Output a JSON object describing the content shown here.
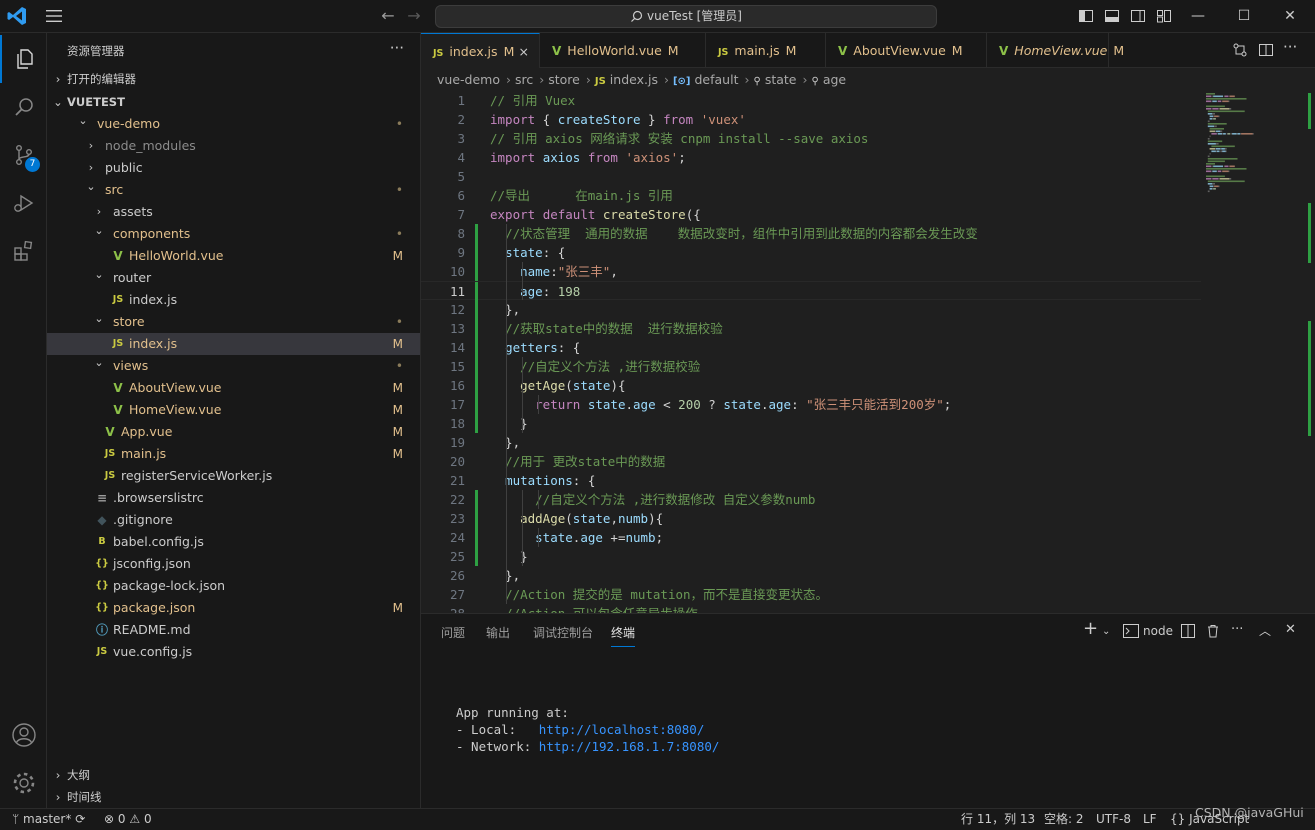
{
  "window": {
    "title": "vueTest [管理员]"
  },
  "explorer": {
    "title": "资源管理器",
    "sections": {
      "open_editors": "打开的编辑器",
      "workspace": "VUETEST",
      "outline": "大纲",
      "timeline": "时间线"
    },
    "tree": [
      {
        "label": "vue-demo",
        "depth": 1,
        "kind": "folder",
        "open": true,
        "deco": "•"
      },
      {
        "label": "node_modules",
        "depth": 2,
        "kind": "folder",
        "open": false,
        "deco": ""
      },
      {
        "label": "public",
        "depth": 2,
        "kind": "folder",
        "open": false,
        "deco": ""
      },
      {
        "label": "src",
        "depth": 2,
        "kind": "folder",
        "open": true,
        "deco": "•"
      },
      {
        "label": "assets",
        "depth": 3,
        "kind": "folder",
        "open": false,
        "deco": ""
      },
      {
        "label": "components",
        "depth": 3,
        "kind": "folder",
        "open": true,
        "deco": "•"
      },
      {
        "label": "HelloWorld.vue",
        "depth": 4,
        "kind": "vue",
        "deco": "M"
      },
      {
        "label": "router",
        "depth": 3,
        "kind": "folder",
        "open": true,
        "deco": ""
      },
      {
        "label": "index.js",
        "depth": 4,
        "kind": "js",
        "deco": ""
      },
      {
        "label": "store",
        "depth": 3,
        "kind": "folder",
        "open": true,
        "deco": "•"
      },
      {
        "label": "index.js",
        "depth": 4,
        "kind": "js",
        "deco": "M",
        "selected": true
      },
      {
        "label": "views",
        "depth": 3,
        "kind": "folder",
        "open": true,
        "deco": "•"
      },
      {
        "label": "AboutView.vue",
        "depth": 4,
        "kind": "vue",
        "deco": "M"
      },
      {
        "label": "HomeView.vue",
        "depth": 4,
        "kind": "vue",
        "deco": "M"
      },
      {
        "label": "App.vue",
        "depth": 3,
        "kind": "vue",
        "deco": "M"
      },
      {
        "label": "main.js",
        "depth": 3,
        "kind": "js",
        "deco": "M"
      },
      {
        "label": "registerServiceWorker.js",
        "depth": 3,
        "kind": "js",
        "deco": ""
      },
      {
        "label": ".browserslistrc",
        "depth": 2,
        "kind": "lines",
        "deco": ""
      },
      {
        "label": ".gitignore",
        "depth": 2,
        "kind": "git",
        "deco": ""
      },
      {
        "label": "babel.config.js",
        "depth": 2,
        "kind": "babel",
        "deco": ""
      },
      {
        "label": "jsconfig.json",
        "depth": 2,
        "kind": "json",
        "deco": ""
      },
      {
        "label": "package-lock.json",
        "depth": 2,
        "kind": "json",
        "deco": ""
      },
      {
        "label": "package.json",
        "depth": 2,
        "kind": "json",
        "deco": "M"
      },
      {
        "label": "README.md",
        "depth": 2,
        "kind": "info",
        "deco": ""
      },
      {
        "label": "vue.config.js",
        "depth": 2,
        "kind": "js",
        "deco": ""
      }
    ]
  },
  "badges": {
    "source_control": "7"
  },
  "tabs": [
    {
      "label": "index.js",
      "icon": "JS",
      "mod": "M",
      "active": true,
      "close": "×"
    },
    {
      "label": "HelloWorld.vue",
      "icon": "V",
      "mod": "M"
    },
    {
      "label": "main.js",
      "icon": "JS",
      "mod": "M"
    },
    {
      "label": "AboutView.vue",
      "icon": "V",
      "mod": "M"
    },
    {
      "label": "HomeView.vue",
      "icon": "V",
      "mod": "M",
      "italic": true
    }
  ],
  "breadcrumb": [
    "vue-demo",
    "src",
    "store",
    "index.js",
    "default",
    "state",
    "age"
  ],
  "code": {
    "current_line": 11,
    "lines": [
      [
        [
          "c",
          "// 引用 Vuex"
        ]
      ],
      [
        [
          "kc",
          "import"
        ],
        [
          "p",
          " { "
        ],
        [
          "v",
          "createStore"
        ],
        [
          "p",
          " } "
        ],
        [
          "kc",
          "from"
        ],
        [
          "p",
          " "
        ],
        [
          "s",
          "'vuex'"
        ]
      ],
      [
        [
          "c",
          "// 引用 axios 网络请求 安装 cnpm install --save axios"
        ]
      ],
      [
        [
          "kc",
          "import"
        ],
        [
          "p",
          " "
        ],
        [
          "v",
          "axios"
        ],
        [
          "p",
          " "
        ],
        [
          "kc",
          "from"
        ],
        [
          "p",
          " "
        ],
        [
          "s",
          "'axios'"
        ],
        [
          "p",
          ";"
        ]
      ],
      [],
      [
        [
          "c",
          "//导出      在main.js 引用"
        ]
      ],
      [
        [
          "kc",
          "export"
        ],
        [
          "p",
          " "
        ],
        [
          "kc",
          "default"
        ],
        [
          "p",
          " "
        ],
        [
          "f",
          "createStore"
        ],
        [
          "p",
          "({"
        ]
      ],
      [
        [
          "p",
          "  "
        ],
        [
          "c",
          "//状态管理  通用的数据    数据改变时，组件中引用到此数据的内容都会发生改变"
        ]
      ],
      [
        [
          "p",
          "  "
        ],
        [
          "v",
          "state"
        ],
        [
          "p",
          ": {"
        ]
      ],
      [
        [
          "p",
          "    "
        ],
        [
          "v",
          "name"
        ],
        [
          "p",
          ":"
        ],
        [
          "s",
          "\"张三丰\""
        ],
        [
          "p",
          ","
        ]
      ],
      [
        [
          "p",
          "    "
        ],
        [
          "v",
          "age"
        ],
        [
          "p",
          ": "
        ],
        [
          "n",
          "198"
        ]
      ],
      [
        [
          "p",
          "  },"
        ]
      ],
      [
        [
          "p",
          "  "
        ],
        [
          "c",
          "//获取state中的数据  进行数据校验"
        ]
      ],
      [
        [
          "p",
          "  "
        ],
        [
          "v",
          "getters"
        ],
        [
          "p",
          ": {"
        ]
      ],
      [
        [
          "p",
          "    "
        ],
        [
          "c",
          "//自定义个方法 ,进行数据校验"
        ]
      ],
      [
        [
          "p",
          "    "
        ],
        [
          "f",
          "getAge"
        ],
        [
          "p",
          "("
        ],
        [
          "v",
          "state"
        ],
        [
          "p",
          "){"
        ]
      ],
      [
        [
          "p",
          "      "
        ],
        [
          "kc",
          "return"
        ],
        [
          "p",
          " "
        ],
        [
          "v",
          "state"
        ],
        [
          "p",
          "."
        ],
        [
          "v",
          "age"
        ],
        [
          "p",
          " < "
        ],
        [
          "n",
          "200"
        ],
        [
          "p",
          " ? "
        ],
        [
          "v",
          "state"
        ],
        [
          "p",
          "."
        ],
        [
          "v",
          "age"
        ],
        [
          "p",
          ": "
        ],
        [
          "s",
          "\"张三丰只能活到200岁\""
        ],
        [
          "p",
          ";"
        ]
      ],
      [
        [
          "p",
          "    }"
        ]
      ],
      [
        [
          "p",
          "  },"
        ]
      ],
      [
        [
          "p",
          "  "
        ],
        [
          "c",
          "//用于 更改state中的数据"
        ]
      ],
      [
        [
          "p",
          "  "
        ],
        [
          "v",
          "mutations"
        ],
        [
          "p",
          ": {"
        ]
      ],
      [
        [
          "p",
          "      "
        ],
        [
          "c",
          "//自定义个方法 ,进行数据修改 自定义参数numb"
        ]
      ],
      [
        [
          "p",
          "    "
        ],
        [
          "f",
          "addAge"
        ],
        [
          "p",
          "("
        ],
        [
          "v",
          "state"
        ],
        [
          "p",
          ","
        ],
        [
          "v",
          "numb"
        ],
        [
          "p",
          "){"
        ]
      ],
      [
        [
          "p",
          "      "
        ],
        [
          "v",
          "state"
        ],
        [
          "p",
          "."
        ],
        [
          "v",
          "age"
        ],
        [
          "p",
          " +="
        ],
        [
          "v",
          "numb"
        ],
        [
          "p",
          ";"
        ]
      ],
      [
        [
          "p",
          "    }"
        ]
      ],
      [
        [
          "p",
          "  },"
        ]
      ],
      [
        [
          "p",
          "  "
        ],
        [
          "c",
          "//Action 提交的是 mutation，而不是直接变更状态。"
        ]
      ],
      [
        [
          "p",
          "  "
        ],
        [
          "c",
          "//Action 可以包含任意异步操作"
        ]
      ]
    ]
  },
  "panel": {
    "tabs": [
      "问题",
      "输出",
      "调试控制台",
      "终端"
    ],
    "active_tab": "终端",
    "terminal_name": "node",
    "terminal": {
      "line1": "App running at:",
      "local_label": "- Local:   ",
      "local_url": "http://localhost:8080/",
      "network_label": "- Network: ",
      "network_url": "http://192.168.1.7:8080/"
    }
  },
  "status": {
    "branch": "master*",
    "errors": "0",
    "warnings": "0",
    "position": "行 11，列 13",
    "spaces": "空格: 2",
    "encoding": "UTF-8",
    "eol": "LF",
    "language": "JavaScript"
  },
  "watermark": "CSDN @javaGHui",
  "colors": {
    "accent": "#0078d4",
    "modified": "#e2c08d",
    "added_gutter": "#2ea043",
    "js_icon": "#cbcb41",
    "vue_icon": "#8dc149"
  }
}
